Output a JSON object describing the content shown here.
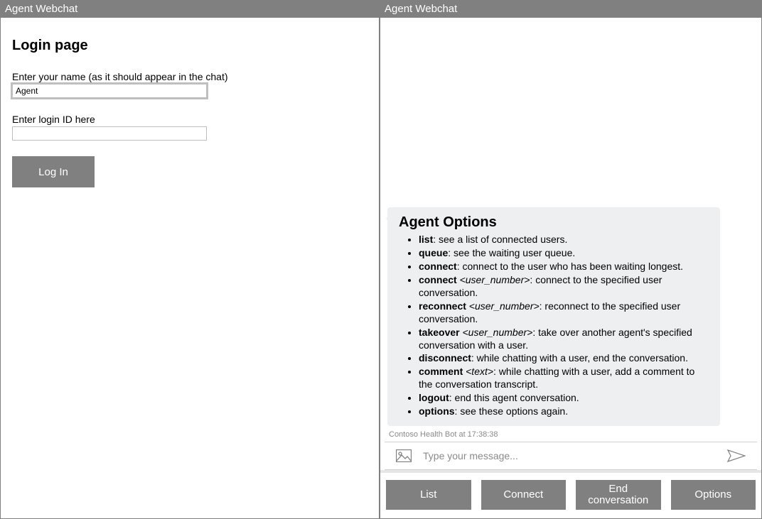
{
  "left": {
    "title": "Agent Webchat",
    "heading": "Login page",
    "name_label": "Enter your name (as it should appear in the chat)",
    "name_value": "Agent",
    "id_label": "Enter login ID here",
    "id_value": "",
    "login_button": "Log In"
  },
  "right": {
    "title": "Agent Webchat",
    "options_heading": "Agent Options",
    "options": [
      {
        "cmd": "list",
        "arg": "",
        "desc": ": see a list of connected users."
      },
      {
        "cmd": "queue",
        "arg": "",
        "desc": ": see the waiting user queue."
      },
      {
        "cmd": "connect",
        "arg": "",
        "desc": ": connect to the user who has been waiting longest."
      },
      {
        "cmd": "connect",
        "arg": " <user_number>",
        "desc": ": connect to the specified user conversation."
      },
      {
        "cmd": "reconnect",
        "arg": " <user_number>",
        "desc": ": reconnect to the specified user conversation."
      },
      {
        "cmd": "takeover",
        "arg": " <user_number>",
        "desc": ": take over another agent's specified conversation with a user."
      },
      {
        "cmd": "disconnect",
        "arg": "",
        "desc": ": while chatting with a user, end the conversation."
      },
      {
        "cmd": "comment",
        "arg": " <text>",
        "desc": ": while chatting with a user, add a comment to the conversation transcript."
      },
      {
        "cmd": "logout",
        "arg": "",
        "desc": ": end this agent conversation."
      },
      {
        "cmd": "options",
        "arg": "",
        "desc": ": see these options again."
      }
    ],
    "timestamp": "Contoso Health Bot at 17:38:38",
    "input_placeholder": "Type your message...",
    "buttons": {
      "list": "List",
      "connect": "Connect",
      "end": "End conversation",
      "options": "Options"
    }
  }
}
